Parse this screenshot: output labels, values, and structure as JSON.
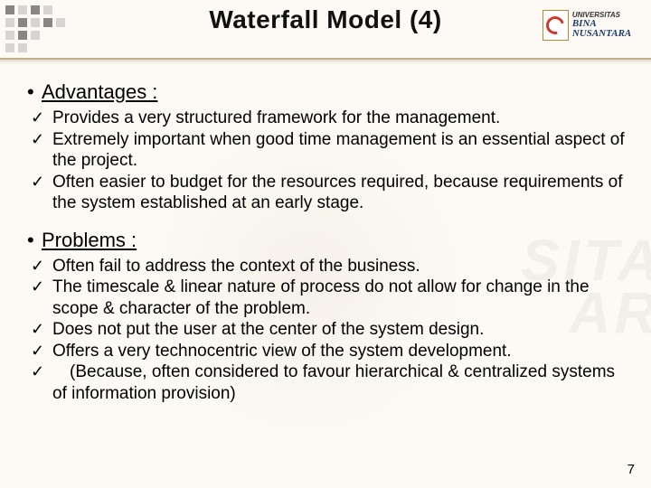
{
  "title": "Waterfall Model (4)",
  "logo": {
    "univ_label": "UNIVERSITAS",
    "org": "BINA NUSANTARA"
  },
  "sections": {
    "advantages": {
      "heading": "Advantages :",
      "items": [
        "Provides a very structured framework for the management.",
        "Extremely important when good time management is an essential aspect of the project.",
        "Often easier to budget for the resources required, because requirements of the system established at an early stage."
      ]
    },
    "problems": {
      "heading": "Problems :",
      "items": [
        "Often fail to address the context of the business.",
        "The timescale & linear nature of process do not allow for change in the scope & character of the problem.",
        "Does not put the user at the center of the system design.",
        "Offers a very technocentric view of the system development.",
        " (Because, often considered to favour hierarchical & centralized systems of information provision)"
      ]
    }
  },
  "watermark": {
    "line1": "SITAS",
    "line2": "ARA"
  },
  "page_number": "7"
}
